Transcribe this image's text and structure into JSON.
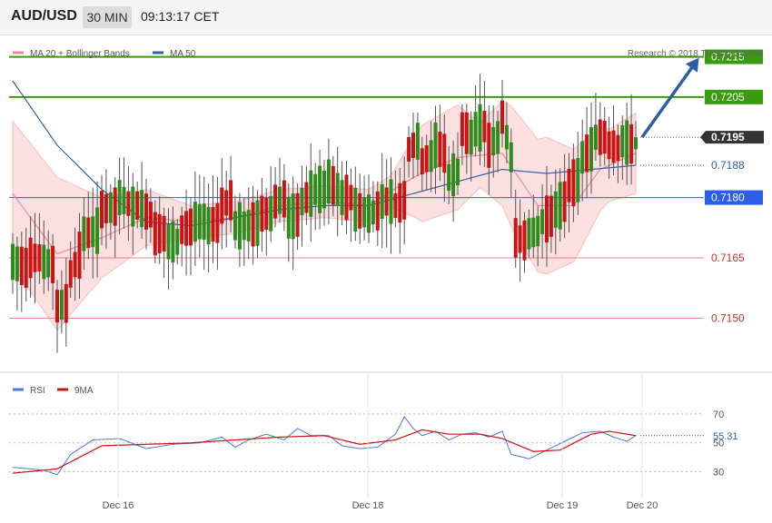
{
  "header": {
    "symbol": "AUD/USD",
    "timeframe": "30 MIN",
    "time": "09:13:17 CET"
  },
  "watermark": "Research © 2018 Trading Central",
  "chart_data": [
    {
      "type": "candlestick",
      "legend": [
        {
          "label": "MA 20 + Bollinger Bands",
          "color": "#f08c8c"
        },
        {
          "label": "MA 50",
          "color": "#2f5fa8"
        }
      ],
      "x_tick_labels": [
        "Dec 16",
        "Dec 18",
        "Dec 19",
        "Dec 20"
      ],
      "ylim": [
        0.7137,
        0.7221
      ],
      "grid": false,
      "levels": [
        {
          "value": "0.7215",
          "style": "resistance",
          "color": "#3a9a10"
        },
        {
          "value": "0.7205",
          "style": "resistance",
          "color": "#3a9a10"
        },
        {
          "value": "0.7195",
          "style": "last-price",
          "color": "#333333"
        },
        {
          "value": "0.7188",
          "style": "ma-value",
          "color": "#2f5fa8"
        },
        {
          "value": "0.7180",
          "style": "pivot",
          "color": "#2a5ee8"
        },
        {
          "value": "0.7165",
          "style": "support",
          "color": "#f08080"
        },
        {
          "value": "0.7150",
          "style": "support",
          "color": "#f08080"
        }
      ],
      "forecast_arrow": {
        "from": 0.7195,
        "to": 0.7215,
        "color": "#2b5ea8"
      },
      "candle_colors": {
        "up": "#2e8b1e",
        "down": "#c81414",
        "wick": "#555555"
      },
      "anchors": [
        [
          0,
          0.7164,
          0.7162
        ],
        [
          4,
          0.7165,
          0.7165
        ],
        [
          7,
          0.7164,
          0.7163
        ],
        [
          10,
          0.7153,
          0.7154
        ],
        [
          13,
          0.7161,
          0.7168
        ],
        [
          16,
          0.7171,
          0.7172
        ],
        [
          20,
          0.7177,
          0.7178
        ],
        [
          24,
          0.718,
          0.7177
        ],
        [
          28,
          0.7178,
          0.7175
        ],
        [
          32,
          0.7171,
          0.7171
        ],
        [
          35,
          0.7169,
          0.7169
        ],
        [
          38,
          0.7172,
          0.7173
        ],
        [
          41,
          0.7174,
          0.7174
        ],
        [
          44,
          0.7173,
          0.7174
        ],
        [
          47,
          0.7178,
          0.718
        ],
        [
          50,
          0.7173,
          0.7173
        ],
        [
          53,
          0.7173,
          0.7174
        ],
        [
          56,
          0.7176,
          0.7176
        ],
        [
          59,
          0.7179,
          0.718
        ],
        [
          62,
          0.7175,
          0.7176
        ],
        [
          65,
          0.7179,
          0.7182
        ],
        [
          68,
          0.7182,
          0.7182
        ],
        [
          71,
          0.7184,
          0.7181
        ],
        [
          74,
          0.718,
          0.718
        ],
        [
          77,
          0.7177,
          0.7176
        ],
        [
          80,
          0.7176,
          0.7177
        ],
        [
          83,
          0.7179,
          0.7179
        ],
        [
          86,
          0.7178,
          0.718
        ],
        [
          89,
          0.7192,
          0.7195
        ],
        [
          92,
          0.7189,
          0.7191
        ],
        [
          95,
          0.7193,
          0.719
        ],
        [
          98,
          0.7185,
          0.7187
        ],
        [
          101,
          0.7197,
          0.7194
        ],
        [
          104,
          0.7197,
          0.7198
        ],
        [
          107,
          0.7193,
          0.7196
        ],
        [
          110,
          0.72,
          0.7185
        ],
        [
          113,
          0.717,
          0.7169
        ],
        [
          116,
          0.7171,
          0.7172
        ],
        [
          119,
          0.7174,
          0.7176
        ],
        [
          122,
          0.7177,
          0.718
        ],
        [
          125,
          0.7183,
          0.7185
        ],
        [
          128,
          0.719,
          0.7193
        ],
        [
          131,
          0.7195,
          0.7195
        ],
        [
          134,
          0.7193,
          0.7192
        ],
        [
          137,
          0.7194,
          0.7193
        ],
        [
          140,
          0.7194,
          0.7195
        ]
      ],
      "ma20_anchor_values": [
        [
          0,
          0.7181
        ],
        [
          10,
          0.7166
        ],
        [
          20,
          0.717
        ],
        [
          30,
          0.7175
        ],
        [
          40,
          0.7174
        ],
        [
          50,
          0.7175
        ],
        [
          60,
          0.7178
        ],
        [
          70,
          0.7179
        ],
        [
          80,
          0.7178
        ],
        [
          90,
          0.7185
        ],
        [
          100,
          0.719
        ],
        [
          110,
          0.7191
        ],
        [
          118,
          0.7178
        ],
        [
          126,
          0.7178
        ],
        [
          132,
          0.7187
        ],
        [
          140,
          0.7191
        ]
      ],
      "ma50_anchor_values": [
        [
          0,
          0.7209
        ],
        [
          10,
          0.7193
        ],
        [
          20,
          0.7182
        ],
        [
          30,
          0.7174
        ],
        [
          40,
          0.7173
        ],
        [
          50,
          0.7175
        ],
        [
          60,
          0.7177
        ],
        [
          70,
          0.7178
        ],
        [
          80,
          0.7178
        ],
        [
          90,
          0.7181
        ],
        [
          100,
          0.7184
        ],
        [
          110,
          0.7187
        ],
        [
          120,
          0.7186
        ],
        [
          130,
          0.7187
        ],
        [
          140,
          0.7188
        ]
      ],
      "band_halfwidth_anchors": [
        [
          0,
          0.0018
        ],
        [
          10,
          0.0019
        ],
        [
          20,
          0.001
        ],
        [
          30,
          0.0007
        ],
        [
          40,
          0.0004
        ],
        [
          55,
          0.0004
        ],
        [
          70,
          0.0004
        ],
        [
          85,
          0.0004
        ],
        [
          92,
          0.0012
        ],
        [
          100,
          0.0013
        ],
        [
          105,
          0.0008
        ],
        [
          112,
          0.0015
        ],
        [
          120,
          0.0017
        ],
        [
          128,
          0.0013
        ],
        [
          134,
          0.0009
        ],
        [
          140,
          0.001
        ]
      ]
    },
    {
      "type": "line",
      "legend": [
        {
          "label": "RSI",
          "color": "#4a7ae0"
        },
        {
          "label": "9MA",
          "color": "#d01010"
        }
      ],
      "ylim": [
        14,
        80
      ],
      "y_tick_labels": [
        "70",
        "50",
        "30"
      ],
      "reference_level": {
        "value": 55,
        "label": "55.31"
      },
      "rsi_anchor_values": [
        [
          0,
          33
        ],
        [
          4,
          32
        ],
        [
          7,
          31
        ],
        [
          10,
          28
        ],
        [
          13,
          42
        ],
        [
          18,
          52
        ],
        [
          24,
          53
        ],
        [
          30,
          46
        ],
        [
          36,
          49
        ],
        [
          42,
          50
        ],
        [
          47,
          54
        ],
        [
          50,
          47
        ],
        [
          53,
          52
        ],
        [
          57,
          56
        ],
        [
          61,
          52
        ],
        [
          64,
          60
        ],
        [
          67,
          55
        ],
        [
          71,
          55
        ],
        [
          74,
          48
        ],
        [
          78,
          46
        ],
        [
          82,
          47
        ],
        [
          86,
          56
        ],
        [
          88,
          68
        ],
        [
          90,
          60
        ],
        [
          92,
          55
        ],
        [
          95,
          58
        ],
        [
          98,
          52
        ],
        [
          101,
          56
        ],
        [
          104,
          57
        ],
        [
          107,
          54
        ],
        [
          110,
          58
        ],
        [
          112,
          42
        ],
        [
          116,
          39
        ],
        [
          120,
          45
        ],
        [
          124,
          51
        ],
        [
          128,
          57
        ],
        [
          132,
          58
        ],
        [
          135,
          54
        ],
        [
          138,
          51
        ],
        [
          140,
          55
        ]
      ],
      "ma9_anchor_values": [
        [
          0,
          29
        ],
        [
          10,
          32
        ],
        [
          20,
          48
        ],
        [
          30,
          49
        ],
        [
          40,
          50
        ],
        [
          50,
          52
        ],
        [
          60,
          54
        ],
        [
          70,
          55
        ],
        [
          78,
          49
        ],
        [
          86,
          52
        ],
        [
          92,
          59
        ],
        [
          98,
          56
        ],
        [
          105,
          56
        ],
        [
          110,
          53
        ],
        [
          117,
          44
        ],
        [
          123,
          45
        ],
        [
          130,
          56
        ],
        [
          134,
          58
        ],
        [
          140,
          55
        ]
      ]
    }
  ]
}
